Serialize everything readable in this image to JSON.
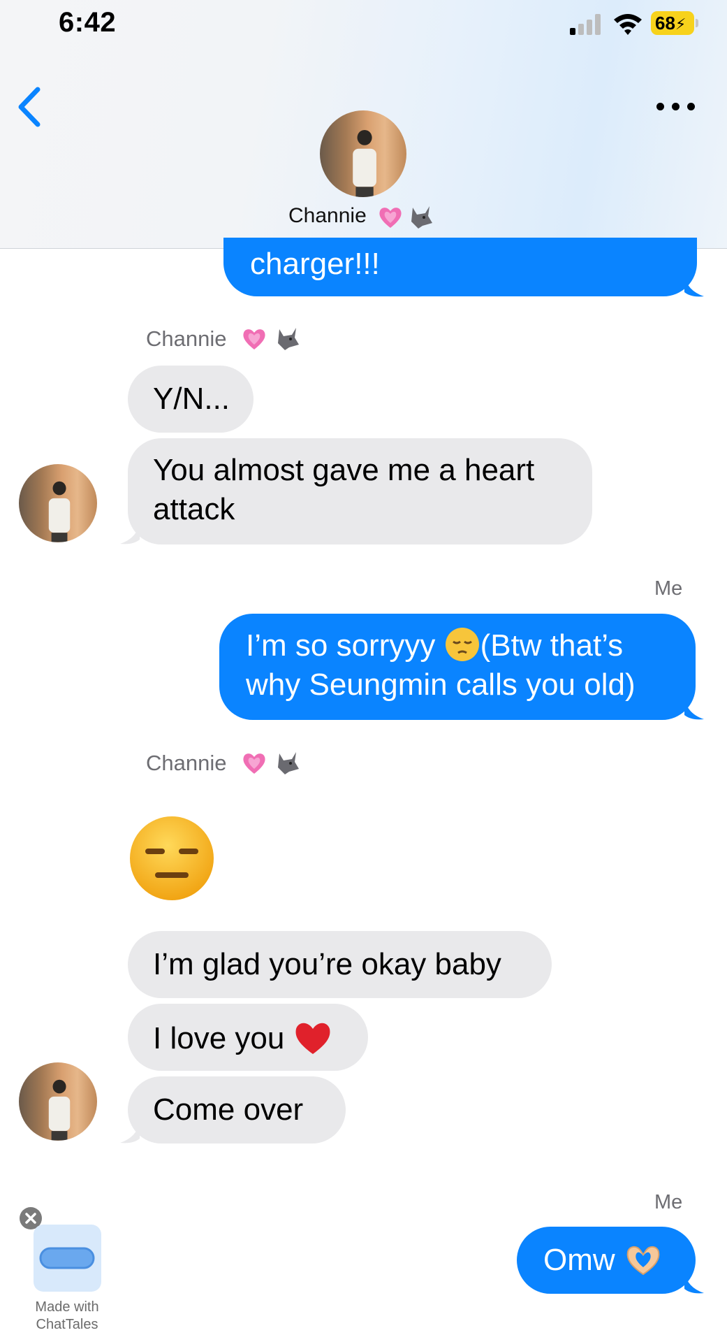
{
  "status_bar": {
    "time": "6:42",
    "battery": "68"
  },
  "header": {
    "contact_name": "Channie",
    "name_emojis": [
      "pink-heart",
      "wolf"
    ]
  },
  "colors": {
    "outgoing": "#0a84ff",
    "incoming": "#e9e9eb",
    "accent": "#0a84ff"
  },
  "messages": {
    "m0": "charger!!!",
    "sender1": "Channie",
    "m1": "Y/N...",
    "m2_line1": "You almost gave me a heart",
    "m2_line2": "attack",
    "me1": "Me",
    "m3_line1a": "I’m so sorryyy ",
    "m3_line1b": "(Btw that’s",
    "m3_line2": "why Seungmin calls you old)",
    "sender2": "Channie",
    "m4_emoji": "expressionless-face",
    "m5": "I’m glad you’re okay baby",
    "m6": "I love you",
    "m7": "Come over",
    "me2": "Me",
    "m8": "Omw"
  },
  "watermark": {
    "line1": "Made with",
    "line2": "ChatTales"
  }
}
